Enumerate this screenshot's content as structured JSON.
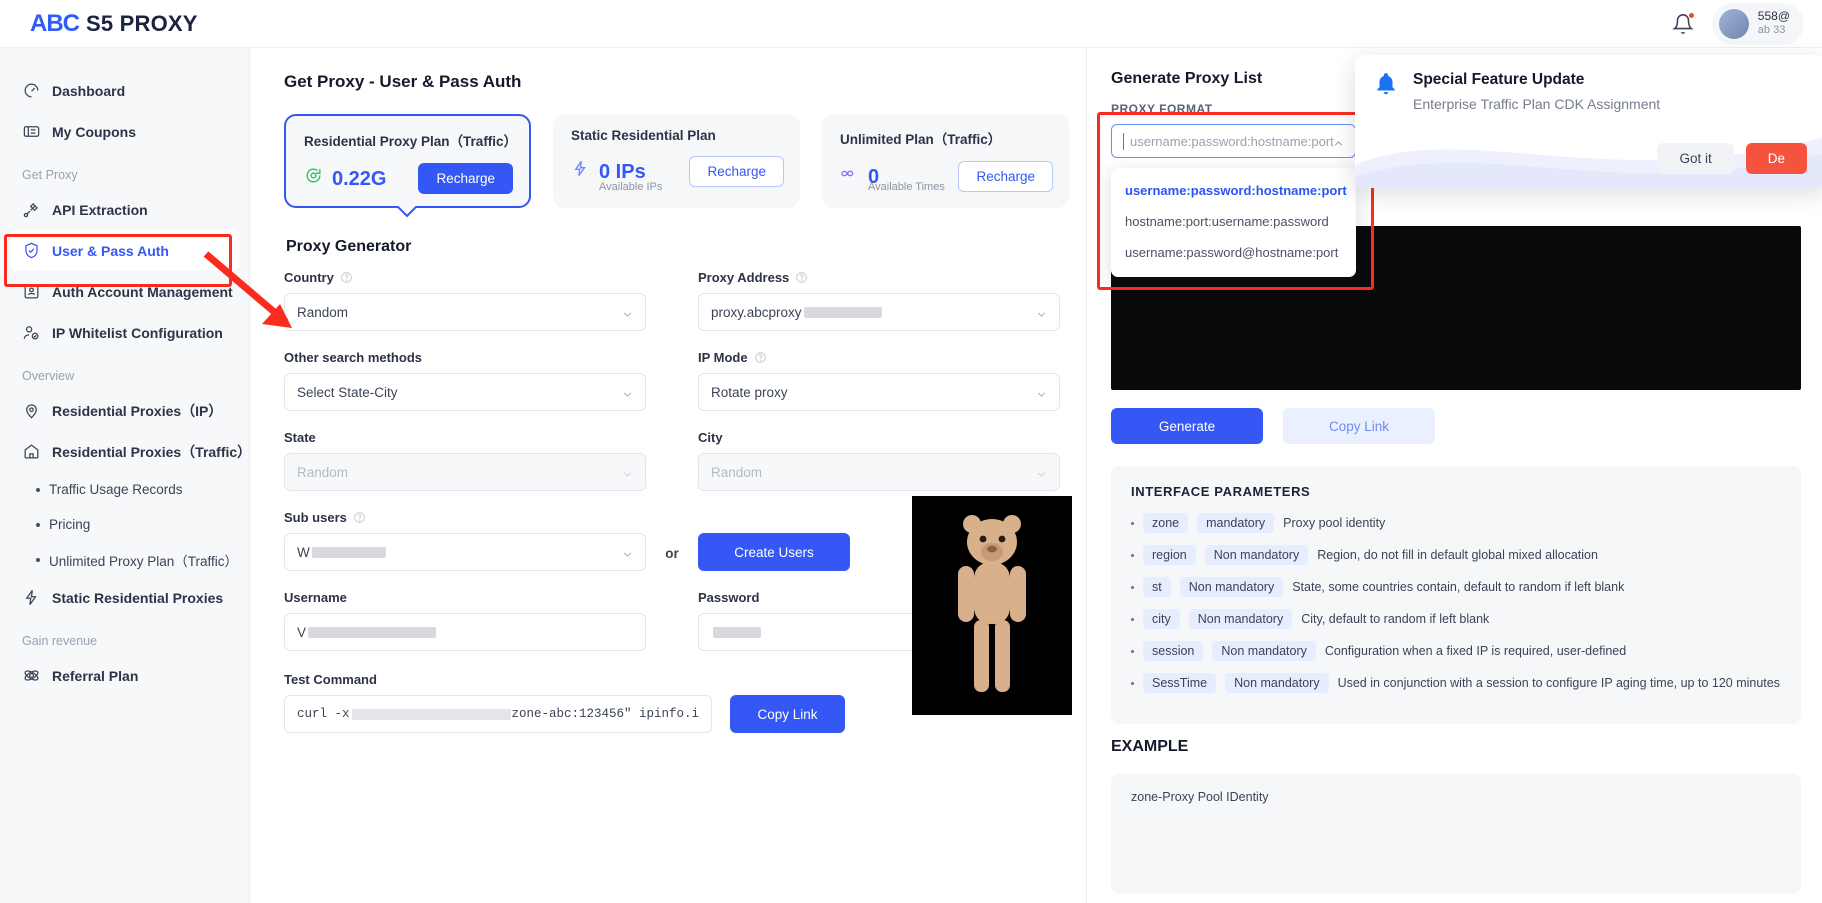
{
  "brand": {
    "abc": "ABC",
    "name": "S5 PROXY"
  },
  "topbar": {
    "bell_icon": "bell-icon",
    "user_email": "558@",
    "user_id": "ab            33"
  },
  "sidebar": {
    "items": [
      {
        "label": "Dashboard",
        "icon": "speedometer-icon"
      },
      {
        "label": "My Coupons",
        "icon": "ticket-icon"
      }
    ],
    "group_get_proxy": "Get Proxy",
    "get_proxy_items": [
      {
        "label": "API Extraction",
        "icon": "plug-icon"
      },
      {
        "label": "User & Pass Auth",
        "icon": "shield-check-icon"
      },
      {
        "label": "Auth Account Management",
        "icon": "user-card-icon"
      },
      {
        "label": "IP Whitelist Configuration",
        "icon": "user-check-icon"
      }
    ],
    "group_overview": "Overview",
    "overview_items": [
      {
        "label": "Residential Proxies（IP）",
        "icon": "pin-icon"
      },
      {
        "label": "Residential Proxies（Traffic）",
        "icon": "home-icon"
      }
    ],
    "overview_sub_items": [
      {
        "label": "Traffic Usage Records"
      },
      {
        "label": "Pricing"
      },
      {
        "label": "Unlimited Proxy Plan（Traffic）"
      }
    ],
    "static_item": {
      "label": "Static Residential Proxies",
      "icon": "bolt-icon"
    },
    "group_gain": "Gain revenue",
    "gain_items": [
      {
        "label": "Referral Plan",
        "icon": "share-icon"
      }
    ]
  },
  "main": {
    "page_title": "Get Proxy - User & Pass Auth",
    "plans": [
      {
        "title": "Residential Proxy Plan（Traffic）",
        "value": "0.22G",
        "sub": "",
        "button": "Recharge",
        "icon": "recycle-icon",
        "selected": true
      },
      {
        "title": "Static Residential Plan",
        "value": "0 IPs",
        "sub": "Available IPs",
        "button": "Recharge",
        "icon": "bolt-icon",
        "selected": false
      },
      {
        "title": "Unlimited Plan（Traffic）",
        "value": "0",
        "sub": "Available Times",
        "button": "Recharge",
        "icon": "infinity-icon",
        "selected": false
      }
    ],
    "generator_title": "Proxy Generator",
    "fields": {
      "country_label": "Country",
      "country_value": "Random",
      "proxy_address_label": "Proxy Address",
      "proxy_address_value": "proxy.abcproxy",
      "other_search_label": "Other search methods",
      "other_search_value": "Select State-City",
      "ip_mode_label": "IP Mode",
      "ip_mode_value": "Rotate proxy",
      "state_label": "State",
      "state_value": "Random",
      "city_label": "City",
      "city_value": "Random",
      "sub_users_label": "Sub users",
      "sub_users_value": "W",
      "or_text": "or",
      "create_users_button": "Create Users",
      "username_label": "Username",
      "username_value": "V",
      "password_label": "Password",
      "password_value": "",
      "test_command_label": "Test Command",
      "test_command_value_prefix": "curl -x ",
      "test_command_value_suffix": "zone-abc:123456\" ipinfo.i",
      "copy_link_button": "Copy Link"
    }
  },
  "right": {
    "title": "Generate Proxy List",
    "proxy_format_label": "PROXY FORMAT",
    "format_placeholder": "username:password:hostname:port",
    "format_options": [
      "username:password:hostname:port",
      "hostname:port:username:password",
      "username:password@hostname:port"
    ],
    "generate_button": "Generate",
    "copy_link_button": "Copy Link",
    "params_title": "INTERFACE PARAMETERS",
    "params": [
      {
        "name": "zone",
        "req": "mandatory",
        "desc": "Proxy pool identity"
      },
      {
        "name": "region",
        "req": "Non mandatory",
        "desc": "Region, do not fill in default global mixed allocation"
      },
      {
        "name": "st",
        "req": "Non mandatory",
        "desc": "State, some countries contain, default to random if left blank"
      },
      {
        "name": "city",
        "req": "Non mandatory",
        "desc": "City, default to random if left blank"
      },
      {
        "name": "session",
        "req": "Non mandatory",
        "desc": "Configuration when a fixed IP is required, user-defined"
      },
      {
        "name": "SessTime",
        "req": "Non mandatory",
        "desc": "Used in conjunction with a session to configure IP aging time, up to 120 minutes"
      }
    ],
    "example_title": "EXAMPLE",
    "example_text": "zone-Proxy Pool IDentity"
  },
  "toast": {
    "icon": "bell-icon",
    "title": "Special Feature Update",
    "body": "Enterprise Traffic Plan CDK Assignment",
    "dismiss_button": "Got it",
    "details_button": "De"
  },
  "colors": {
    "accent": "#3557f6",
    "highlight": "#fb2c1e",
    "danger": "#f5533d",
    "sidebar_bg": "#f7f8fa"
  }
}
